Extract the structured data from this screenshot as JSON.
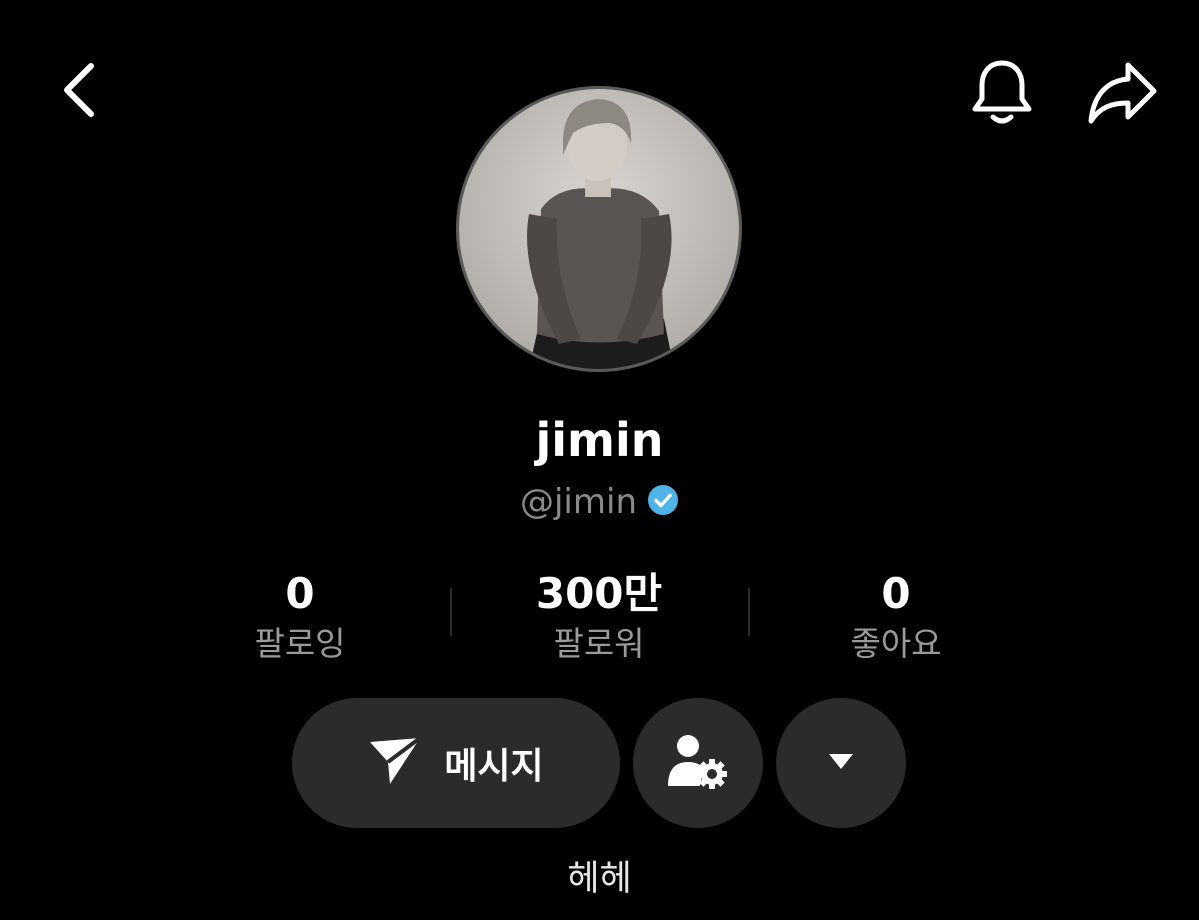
{
  "header": {
    "back_icon": "chevron-left-icon",
    "notification_icon": "bell-icon",
    "share_icon": "share-arrow-icon"
  },
  "profile": {
    "display_name": "jimin",
    "handle": "@jimin",
    "verified": true,
    "verified_color": "#4fb3e8",
    "bio": "헤헤"
  },
  "stats": {
    "following": {
      "value": "0",
      "label": "팔로잉"
    },
    "followers": {
      "value": "300만",
      "label": "팔로워"
    },
    "likes": {
      "value": "0",
      "label": "좋아요"
    }
  },
  "actions": {
    "message_label": "메시지",
    "message_icon": "paper-plane-icon",
    "profile_settings_icon": "user-gear-icon",
    "more_icon": "caret-down-icon"
  },
  "colors": {
    "background": "#000000",
    "button_bg": "#2b2b2b",
    "secondary_text": "#8a8a8a"
  }
}
